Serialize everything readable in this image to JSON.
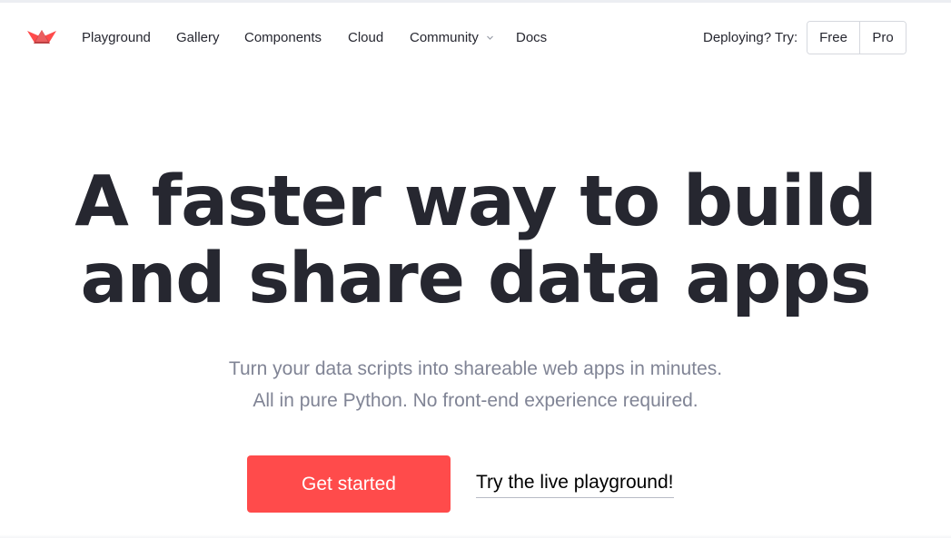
{
  "nav": {
    "logo_icon": "streamlit-crown-logo-icon",
    "links": [
      {
        "label": "Playground"
      },
      {
        "label": "Gallery"
      },
      {
        "label": "Components"
      },
      {
        "label": "Cloud"
      },
      {
        "label": "Community"
      },
      {
        "label": "Docs"
      }
    ],
    "community_dropdown_icon": "chevron-down-icon",
    "deploy_label": "Deploying? Try:",
    "plans": {
      "free_label": "Free",
      "pro_label": "Pro"
    }
  },
  "hero": {
    "headline_line1": "A faster way to build",
    "headline_line2": "and share data apps",
    "subtitle_line1": "Turn your data scripts into shareable web apps in minutes.",
    "subtitle_line2": "All in pure Python. No front-end experience required.",
    "cta_label": "Get started",
    "secondary_link": "Try the live playground!"
  },
  "colors": {
    "brand_red": "#ff4b4b",
    "text_dark": "#262730",
    "text_muted": "#808495",
    "border": "#d5d8de"
  }
}
